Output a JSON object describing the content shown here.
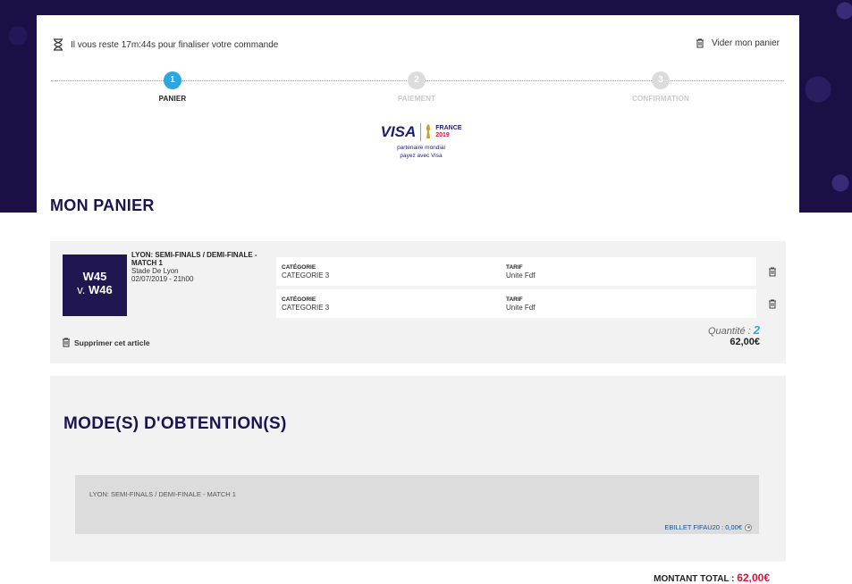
{
  "header": {
    "timer_text": "Il vous reste 17m:44s pour finaliser votre commande",
    "empty_cart": "Vider mon panier"
  },
  "steps": [
    {
      "num": "1",
      "label": "PANIER",
      "state": "active"
    },
    {
      "num": "2",
      "label": "PAIEMENT",
      "state": "inactive"
    },
    {
      "num": "3",
      "label": "CONFIRMATION",
      "state": "inactive"
    }
  ],
  "sponsor": {
    "visa": "VISA",
    "france_line1": "FRANCE",
    "france_line2": "2019",
    "line1": "partenaire mondial",
    "line2": "payez avec Visa"
  },
  "page_title": "MON PANIER",
  "cart": {
    "thumb_line1": "W45",
    "thumb_v": "v.",
    "thumb_line2": "W46",
    "match_name": "LYON: SEMI-FINALS / DEMI-FINALE - MATCH 1",
    "venue": "Stade De Lyon",
    "datetime": "02/07/2019 - 21h00",
    "tickets": [
      {
        "cat_label": "CATÉGORIE",
        "cat_value": "CATEGORIE 3",
        "tarif_label": "TARIF",
        "tarif_value": "Unite Fdf"
      },
      {
        "cat_label": "CATÉGORIE",
        "cat_value": "CATEGORIE 3",
        "tarif_label": "TARIF",
        "tarif_value": "Unite Fdf"
      }
    ],
    "remove": "Supprimer cet article",
    "qty_label": "Quantité :",
    "qty_value": "2",
    "price": "62,00€"
  },
  "delivery": {
    "title": "MODE(S) D'OBTENTION(S)",
    "match": "LYON: SEMI-FINALS / DEMI-FINALE - MATCH 1",
    "option": "EBILLET FIFAU20 : 0,00€"
  },
  "total": {
    "label": "MONTANT TOTAL :",
    "value": "62,00€"
  },
  "colors": {
    "navy": "#1b1451",
    "accent_blue": "#2aa7e0",
    "total_red": "#d4143c",
    "banner": "#1b0f45"
  }
}
